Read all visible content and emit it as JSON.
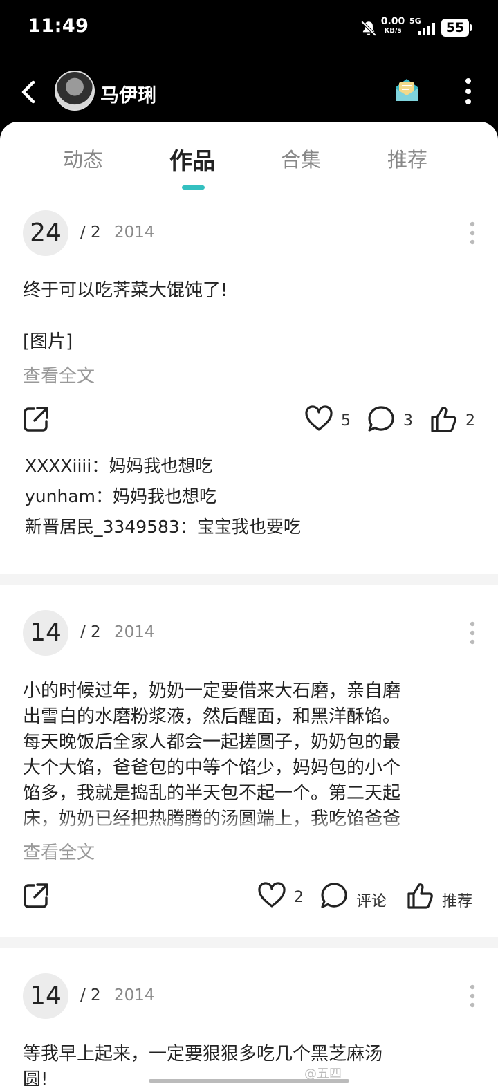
{
  "status_bar": {
    "time": "11:49",
    "speed_value": "0.00",
    "speed_unit": "KB/s",
    "network": "5G",
    "battery": "55",
    "icons": [
      "bell-muted-icon",
      "signal-icon"
    ]
  },
  "header": {
    "back_icon": "chevron-left-icon",
    "user_name": "马伊琍",
    "mail_icon": "mail-icon",
    "more_icon": "more-vertical-icon"
  },
  "tabs": [
    {
      "label": "动态",
      "active": false
    },
    {
      "label": "作品",
      "active": true
    },
    {
      "label": "合集",
      "active": false
    },
    {
      "label": "推荐",
      "active": false
    }
  ],
  "accent_color": "#34c0c0",
  "posts": [
    {
      "day": "24",
      "month": "/ 2",
      "year": "2014",
      "lines": [
        "终于可以吃荠菜大馄饨了!",
        "",
        "[图片]"
      ],
      "read_more": "查看全文",
      "likes": "5",
      "comments": "3",
      "recommends": "2",
      "comment_list": [
        {
          "user": "XXXXiiii",
          "text": "妈妈我也想吃"
        },
        {
          "user": "yunham",
          "text": "妈妈我也想吃"
        },
        {
          "user": "新晋居民_3349583",
          "text": "宝宝我也要吃"
        }
      ]
    },
    {
      "day": "14",
      "month": "/ 2",
      "year": "2014",
      "lines": [
        "小的时候过年，奶奶一定要借来大石磨，亲自磨",
        "出雪白的水磨粉浆液，然后醒面，和黑洋酥馅。",
        "每天晚饭后全家人都会一起搓圆子，奶奶包的最",
        "大个大馅，爸爸包的中等个馅少，妈妈包的小个",
        "馅多，我就是捣乱的半天包不起一个。第二天起",
        "床，奶奶已经把热腾腾的汤圆端上，我吃馅爸爸"
      ],
      "read_more": "查看全文",
      "likes": "2",
      "comments": "评论",
      "recommends": "推荐"
    },
    {
      "day": "14",
      "month": "/ 2",
      "year": "2014",
      "lines": [
        "等我早上起来，一定要狠狠多吃几个黑芝麻汤",
        "圆!"
      ]
    }
  ],
  "watermark": "@五四"
}
